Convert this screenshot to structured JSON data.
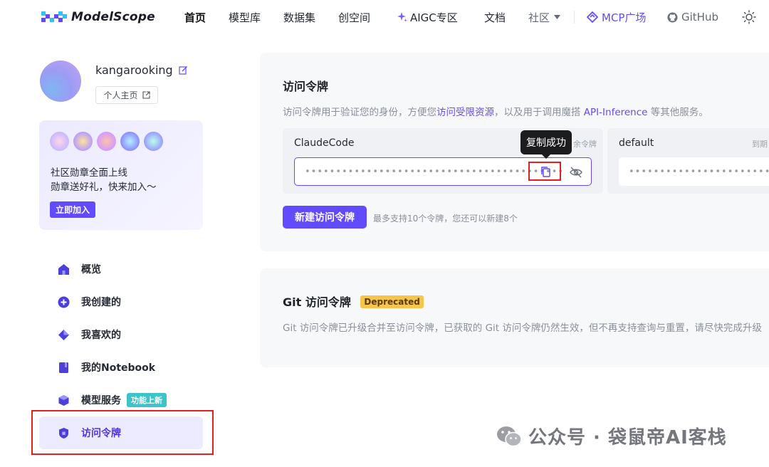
{
  "header": {
    "logo_text": "ModelScope",
    "nav": {
      "home": "首页",
      "models": "模型库",
      "datasets": "数据集",
      "studios": "创空间",
      "aigc": "AIGC专区",
      "docs": "文档",
      "community": "社区",
      "mcp": "MCP广场",
      "github": "GitHub"
    },
    "active_nav": "home"
  },
  "profile": {
    "username": "kangarooking",
    "homepage_button": "个人主页"
  },
  "badge_card": {
    "line1": "社区勋章全面上线",
    "line2": "勋章送好礼，快来加入～",
    "join_button": "立即加入"
  },
  "sidebar": {
    "items": [
      {
        "label": "概览",
        "icon": "home-icon"
      },
      {
        "label": "我创建的",
        "icon": "plus-circle-icon"
      },
      {
        "label": "我喜欢的",
        "icon": "diamond-icon"
      },
      {
        "label": "我的Notebook",
        "icon": "notebook-icon"
      },
      {
        "label": "模型服务",
        "icon": "cube-icon",
        "tag": "功能上新"
      },
      {
        "label": "访问令牌",
        "icon": "shield-icon"
      }
    ],
    "active_index": 5
  },
  "access_token": {
    "title": "访问令牌",
    "desc_before": "访问令牌用于验证您的身份，方便您",
    "desc_link1": "访问受限资源",
    "desc_middle": "，以及用于调用魔搭 ",
    "desc_link2": "API-Inference",
    "desc_after": " 等其他服务。",
    "tokens": [
      {
        "name": "ClaudeCode",
        "meta": "余令牌",
        "masked": "••••••••••••••••••••••••••••••••••••••••••"
      },
      {
        "name": "default",
        "meta": "到期",
        "masked": "••••••••••••••••••••••••••••••••••••••••••"
      }
    ],
    "tooltip": "复制成功",
    "create_button": "新建访问令牌",
    "create_note": "最多支持10个令牌，您还可以新建8个"
  },
  "git_token": {
    "title": "Git 访问令牌",
    "badge": "Deprecated",
    "desc": "Git 访问令牌已升级合并至访问令牌，已获取的 Git 访问令牌仍然生效，但不再支持查询与重置，请尽快完成升级"
  },
  "watermark": {
    "text": "公众号 · 袋鼠帝AI客栈"
  },
  "colors": {
    "accent": "#624aff",
    "highlight_red": "#e02020",
    "deprecated": "#f6c54a"
  }
}
